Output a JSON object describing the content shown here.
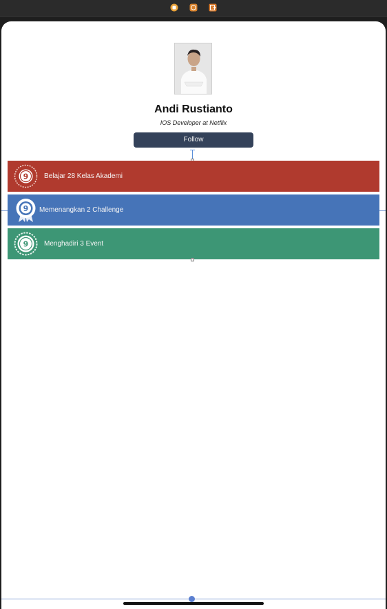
{
  "toolbar": {
    "icons": [
      "view-controller-icon",
      "first-responder-icon",
      "exit-icon"
    ],
    "accent": "#e0a030"
  },
  "profile": {
    "name": "Andi Rustianto",
    "role": "IOS Developer at Netflix",
    "follow_label": "Follow"
  },
  "achievements": [
    {
      "label": "Belajar 28 Kelas Akademi",
      "badge_number": "9",
      "color": "#b03a2e",
      "icon": "laurel-badge-icon"
    },
    {
      "label": "Memenangkan 2 Challenge",
      "badge_number": "9",
      "color": "#4674b8",
      "icon": "ribbon-badge-icon"
    },
    {
      "label": "Menghadiri 3 Event",
      "badge_number": "9",
      "color": "#3d9675",
      "icon": "gear-badge-icon"
    }
  ]
}
